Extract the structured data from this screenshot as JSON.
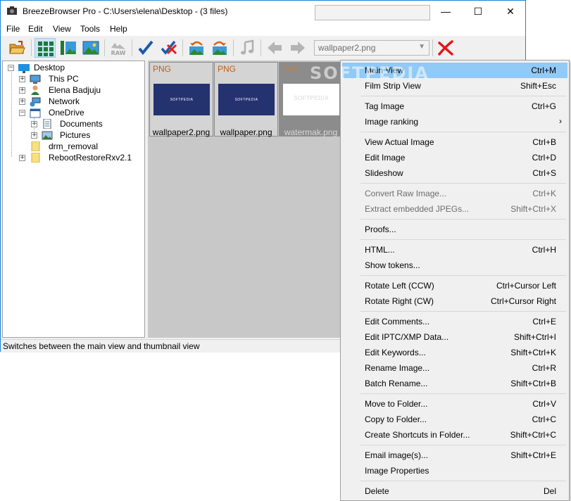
{
  "window": {
    "title": "BreezeBrowser Pro - C:\\Users\\elena\\Desktop - (3 files)",
    "caption_min": "—",
    "caption_max": "☐",
    "caption_close": "✕"
  },
  "menubar": [
    "File",
    "Edit",
    "View",
    "Tools",
    "Help"
  ],
  "toolbar": {
    "combo_value": "wallpaper2.png",
    "raw_label": "RAW"
  },
  "tree": {
    "items": [
      {
        "label": "Desktop"
      },
      {
        "label": "This PC"
      },
      {
        "label": "Elena Badjuju"
      },
      {
        "label": "Network"
      },
      {
        "label": "OneDrive"
      },
      {
        "label": "Documents"
      },
      {
        "label": "Pictures"
      },
      {
        "label": "drm_removal"
      },
      {
        "label": "RebootRestoreRxv2.1"
      }
    ]
  },
  "thumbnails": [
    {
      "format": "PNG",
      "name": "wallpaper2.png",
      "caption": "SOFTPEDIA"
    },
    {
      "format": "PNG",
      "name": "wallpaper.png",
      "caption": "SOFTPEDIA"
    },
    {
      "format": "PNG",
      "name": "watermak.png",
      "caption": "SOFTPEDIA"
    }
  ],
  "statusbar": {
    "text": "Switches between the main view and thumbnail view"
  },
  "watermark": "SOFTPEDIA",
  "context_menu": {
    "items": [
      {
        "label": "Main View",
        "shortcut": "Ctrl+M"
      },
      {
        "label": "Film Strip View",
        "shortcut": "Shift+Esc"
      },
      {
        "label": "Tag Image",
        "shortcut": "Ctrl+G"
      },
      {
        "label": "Image ranking",
        "shortcut": "",
        "submenu": "›"
      },
      {
        "label": "View Actual Image",
        "shortcut": "Ctrl+B"
      },
      {
        "label": "Edit Image",
        "shortcut": "Ctrl+D"
      },
      {
        "label": "Slideshow",
        "shortcut": "Ctrl+S"
      },
      {
        "label": "Convert Raw Image...",
        "shortcut": "Ctrl+K"
      },
      {
        "label": "Extract embedded JPEGs...",
        "shortcut": "Shift+Ctrl+X"
      },
      {
        "label": "Proofs...",
        "shortcut": ""
      },
      {
        "label": "HTML...",
        "shortcut": "Ctrl+H"
      },
      {
        "label": "Show tokens...",
        "shortcut": ""
      },
      {
        "label": "Rotate Left (CCW)",
        "shortcut": "Ctrl+Cursor Left"
      },
      {
        "label": "Rotate Right (CW)",
        "shortcut": "Ctrl+Cursor Right"
      },
      {
        "label": "Edit Comments...",
        "shortcut": "Ctrl+E"
      },
      {
        "label": "Edit IPTC/XMP Data...",
        "shortcut": "Shift+Ctrl+I"
      },
      {
        "label": "Edit Keywords...",
        "shortcut": "Shift+Ctrl+K"
      },
      {
        "label": "Rename Image...",
        "shortcut": "Ctrl+R"
      },
      {
        "label": "Batch Rename...",
        "shortcut": "Shift+Ctrl+B"
      },
      {
        "label": "Move to Folder...",
        "shortcut": "Ctrl+V"
      },
      {
        "label": "Copy to Folder...",
        "shortcut": "Ctrl+C"
      },
      {
        "label": "Create Shortcuts in Folder...",
        "shortcut": "Shift+Ctrl+C"
      },
      {
        "label": "Email image(s)...",
        "shortcut": "Shift+Ctrl+E"
      },
      {
        "label": "Image Properties",
        "shortcut": ""
      },
      {
        "label": "Delete",
        "shortcut": "Del"
      }
    ]
  },
  "colors": {
    "menu_highlight": "#91c9f7",
    "window_border": "#1883d7",
    "png_label": "#c06010",
    "thumb_image": "#253270"
  }
}
